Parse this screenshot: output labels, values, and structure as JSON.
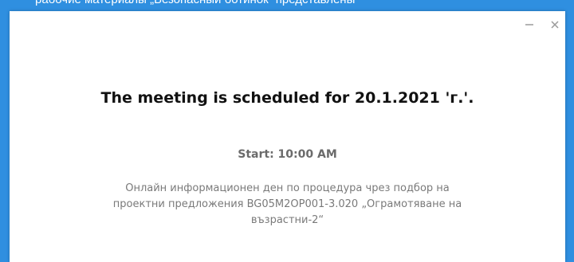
{
  "backdrop": {
    "text": "рабочие материалы „Безопасный ботинок“ представлены"
  },
  "window_controls": {
    "minimize_icon": "minimize-icon",
    "close_icon": "close-icon"
  },
  "dialog": {
    "title": "The meeting is scheduled for 20.1.2021 'г.'.",
    "start": "Start: 10:00 AM",
    "description_lines": [
      "Онлайн информационен ден по процедура чрез подбор на",
      "проектни предложения BG05M2OP001-3.020 „Ограмотяване на",
      "възрастни-2“"
    ]
  },
  "colors": {
    "backdrop": "#2f8fe0",
    "dialog_bg": "#ffffff",
    "title": "#111111",
    "start": "#6b6b6b",
    "description": "#7a7a7a"
  }
}
